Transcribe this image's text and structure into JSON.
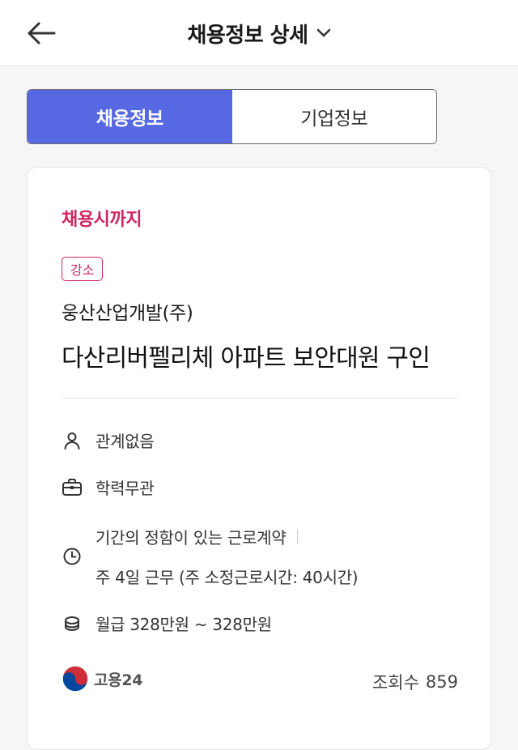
{
  "header": {
    "title": "채용정보 상세"
  },
  "tabs": [
    {
      "label": "채용정보",
      "active": true
    },
    {
      "label": "기업정보",
      "active": false
    }
  ],
  "job": {
    "deadline": "채용시까지",
    "region": "강소",
    "company": "웅산산업개발(주)",
    "title": "다산리버펠리체 아파트 보안대원 구인",
    "career": "관계없음",
    "education": "학력무관",
    "contract_type": "기간의 정함이 있는 근로계약",
    "work_schedule": "주 4일 근무 (주 소정근로시간: 40시간)",
    "salary": "월급 328만원 ~ 328만원"
  },
  "footer": {
    "source_name": "고용24",
    "views_label": "조회수",
    "views_count": "859"
  },
  "icons": {
    "back": "arrow-left-icon",
    "dropdown": "chevron-down-icon",
    "career": "person-icon",
    "education": "briefcase-icon",
    "contract": "clock-icon",
    "salary": "coins-icon",
    "source_logo": "korea-taegeuk-logo"
  },
  "colors": {
    "accent": "#5668e2",
    "deadline": "#d1255f",
    "logo_red": "#cd2e3a",
    "logo_blue": "#0047a0"
  }
}
